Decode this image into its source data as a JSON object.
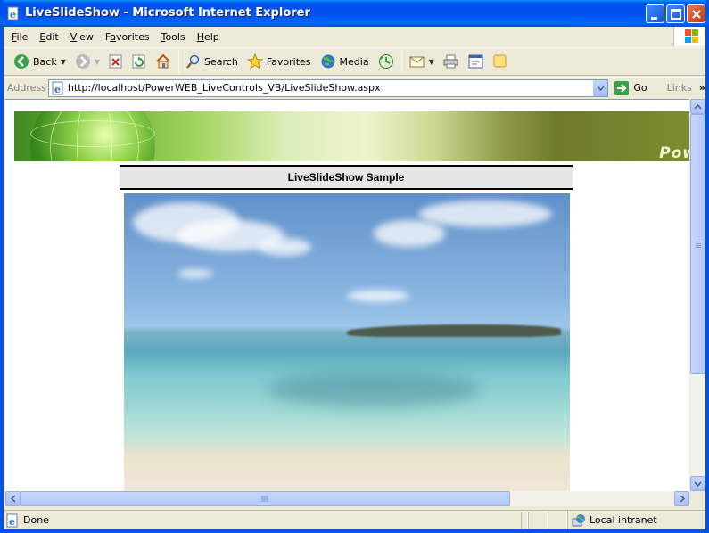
{
  "window": {
    "title": "LiveSlideShow - Microsoft Internet Explorer"
  },
  "menu": [
    {
      "label_u": "F",
      "label_rest": "ile"
    },
    {
      "label_u": "E",
      "label_rest": "dit"
    },
    {
      "label_u": "V",
      "label_rest": "iew"
    },
    {
      "label_u": "",
      "label_pre": "F",
      "label_ua": "a",
      "label_rest": "vorites"
    },
    {
      "label_u": "T",
      "label_rest": "ools"
    },
    {
      "label_u": "H",
      "label_rest": "elp"
    }
  ],
  "toolbar": {
    "back_label": "Back",
    "search_label": "Search",
    "favorites_label": "Favorites",
    "media_label": "Media"
  },
  "address": {
    "label": "Address",
    "url": "http://localhost/PowerWEB_LiveControls_VB/LiveSlideShow.aspx",
    "go_label": "Go",
    "links_label": "Links"
  },
  "page": {
    "banner_text": "Pow",
    "sample_title": "LiveSlideShow Sample"
  },
  "status": {
    "text": "Done",
    "zone": "Local intranet"
  }
}
